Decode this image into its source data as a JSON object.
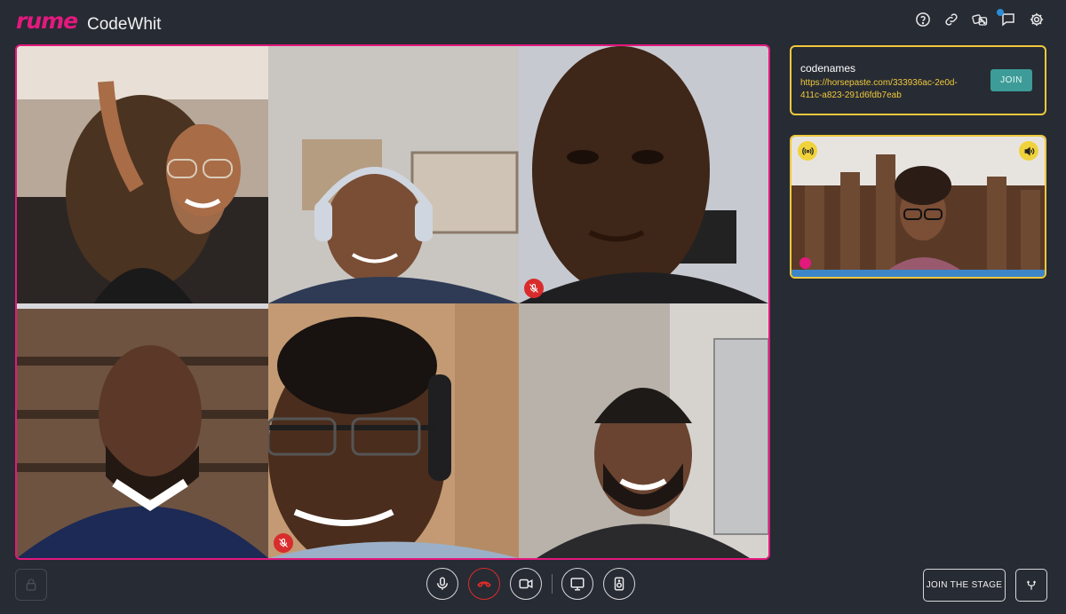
{
  "app": {
    "logo_text": "rume",
    "room_name": "CodeWhit",
    "brand_color": "#e3197e",
    "accent_color": "#f0c93c"
  },
  "top_icons": [
    "help-icon",
    "link-icon",
    "dice-icon",
    "chat-icon",
    "settings-icon"
  ],
  "video_grid": {
    "tiles": [
      {
        "name": "participant-1",
        "muted": false
      },
      {
        "name": "participant-2",
        "muted": false
      },
      {
        "name": "participant-3",
        "muted": true
      },
      {
        "name": "participant-4",
        "muted": false
      },
      {
        "name": "participant-5",
        "muted": true
      },
      {
        "name": "participant-6",
        "muted": false
      }
    ]
  },
  "game_card": {
    "title": "codenames",
    "link": "https://horsepaste.com/333936ac-2e0d-411c-a823-291d6fdb7eab",
    "join_label": "JOIN"
  },
  "stage": {
    "speaker_icon": "broadcast-icon",
    "volume_icon": "volume-icon"
  },
  "controls": {
    "mic": "microphone-icon",
    "hangup": "phone-hangup-icon",
    "camera": "video-camera-icon",
    "screen": "screen-share-icon",
    "speaker": "speaker-icon",
    "join_stage_label": "JOIN THE STAGE"
  }
}
